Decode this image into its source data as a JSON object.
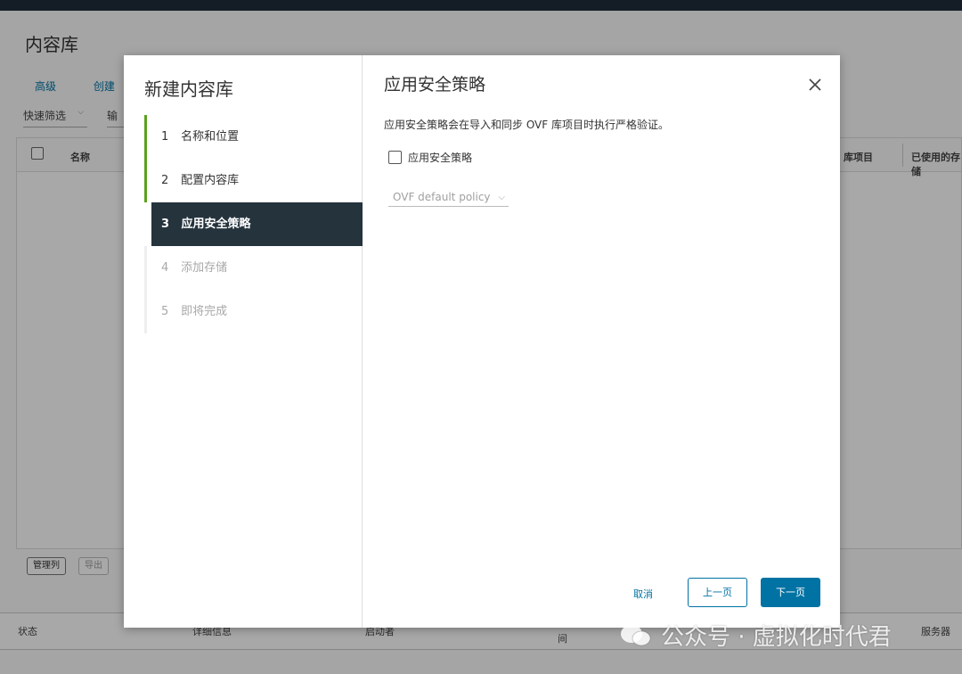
{
  "background": {
    "page_title": "内容库",
    "actions": [
      "高级",
      "创建"
    ],
    "quick_filter": "快速筛选",
    "filter_input": "输",
    "grid_columns": {
      "name": "名称",
      "items": "库项目",
      "used_storage": "已使用的存储"
    },
    "footer_buttons": {
      "manage_columns": "管理列",
      "export": "导出"
    },
    "bottom_columns": {
      "status": "状态",
      "details": "详细信息",
      "initiator": "启动者",
      "time": "间",
      "server": "服务器"
    }
  },
  "modal": {
    "left_title": "新建内容库",
    "steps": [
      {
        "num": "1",
        "label": "名称和位置",
        "state": "done"
      },
      {
        "num": "2",
        "label": "配置内容库",
        "state": "done"
      },
      {
        "num": "3",
        "label": "应用安全策略",
        "state": "active"
      },
      {
        "num": "4",
        "label": "添加存储",
        "state": "todo"
      },
      {
        "num": "5",
        "label": "即将完成",
        "state": "todo"
      }
    ],
    "right_title": "应用安全策略",
    "description": "应用安全策略会在导入和同步 OVF 库项目时执行严格验证。",
    "checkbox_label": "应用安全策略",
    "checkbox_checked": false,
    "policy_select": {
      "value": "OVF default policy"
    },
    "buttons": {
      "cancel": "取消",
      "prev": "上一页",
      "next": "下一页"
    }
  },
  "watermark": "公众号 · 虚拟化时代君",
  "colors": {
    "accent": "#0072a3",
    "done_bar": "#5aa220",
    "active_step_bg": "#25333d"
  }
}
